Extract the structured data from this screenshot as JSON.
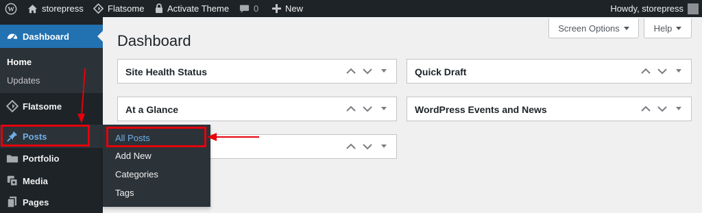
{
  "admin_bar": {
    "site_name": "storepress",
    "theme_name": "Flatsome",
    "activate_theme": "Activate Theme",
    "comments_count": "0",
    "new_label": "New",
    "howdy": "Howdy, storepress"
  },
  "sidebar": {
    "dashboard": "Dashboard",
    "dashboard_sub": {
      "home": "Home",
      "updates": "Updates"
    },
    "flatsome": "Flatsome",
    "posts": "Posts",
    "portfolio": "Portfolio",
    "media": "Media",
    "pages": "Pages"
  },
  "posts_flyout": {
    "all_posts": "All Posts",
    "add_new": "Add New",
    "categories": "Categories",
    "tags": "Tags"
  },
  "main": {
    "title": "Dashboard",
    "screen_options": "Screen Options",
    "help": "Help",
    "widgets": {
      "site_health": "Site Health Status",
      "at_a_glance": "At a Glance",
      "quick_draft": "Quick Draft",
      "wp_events": "WordPress Events and News",
      "third": ""
    }
  },
  "colors": {
    "admin_bar_bg": "#1d2327",
    "menu_active": "#2271b1",
    "link_blue": "#72aee6",
    "highlight_red": "#e5000b"
  }
}
